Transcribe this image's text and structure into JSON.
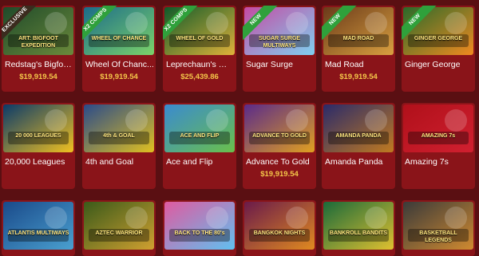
{
  "games": [
    {
      "title": "Redstag's Bigfoo...",
      "jackpot": "$19,919.54",
      "badge": "EXCLUSIVE",
      "badge_style": "dark",
      "art": "ART: BIGFOOT EXPEDITION",
      "bg": [
        "#1f4a2a",
        "#6b8a3b"
      ]
    },
    {
      "title": "Wheel Of Chanc...",
      "jackpot": "$19,919.54",
      "badge": "X2 COMPS",
      "badge_style": "green",
      "art": "WHEEL OF CHANCE",
      "bg": [
        "#1b6b8a",
        "#7bd36a"
      ]
    },
    {
      "title": "Leprechaun's Wh...",
      "jackpot": "$25,439.86",
      "badge": "X2 COMPS",
      "badge_style": "green",
      "art": "WHEEL OF GOLD",
      "bg": [
        "#0f5a2a",
        "#e0b23a"
      ]
    },
    {
      "title": "Sugar Surge",
      "jackpot": "",
      "badge": "NEW",
      "badge_style": "green",
      "art": "SUGAR SURGE MULTIWAYS",
      "bg": [
        "#c54aa3",
        "#7fd0f0"
      ]
    },
    {
      "title": "Mad Road",
      "jackpot": "$19,919.54",
      "badge": "NEW",
      "badge_style": "green",
      "art": "MAD ROAD",
      "bg": [
        "#6a3a1a",
        "#d9a040"
      ]
    },
    {
      "title": "Ginger George",
      "jackpot": "",
      "badge": "NEW",
      "badge_style": "green",
      "art": "GINGER GEORGE",
      "bg": [
        "#2a6a2a",
        "#f08a20"
      ]
    },
    {
      "title": "20,000 Leagues",
      "jackpot": "",
      "badge": "",
      "badge_style": "",
      "art": "20 000 LEAGUES",
      "bg": [
        "#0a3a6a",
        "#f0c020"
      ]
    },
    {
      "title": "4th and Goal",
      "jackpot": "",
      "badge": "",
      "badge_style": "",
      "art": "4th & GOAL",
      "bg": [
        "#2a4a8a",
        "#e0c020"
      ]
    },
    {
      "title": "Ace and Flip",
      "jackpot": "",
      "badge": "",
      "badge_style": "",
      "art": "ACE AND FLIP",
      "bg": [
        "#3a8ad0",
        "#6ac04a"
      ]
    },
    {
      "title": "Advance To Gold",
      "jackpot": "$19,919.54",
      "badge": "",
      "badge_style": "",
      "art": "ADVANCE TO GOLD",
      "bg": [
        "#5a2a8a",
        "#e0a020"
      ]
    },
    {
      "title": "Amanda Panda",
      "jackpot": "",
      "badge": "",
      "badge_style": "",
      "art": "AMANDA PANDA",
      "bg": [
        "#2a2a6a",
        "#c07a20"
      ]
    },
    {
      "title": "Amazing 7s",
      "jackpot": "",
      "badge": "",
      "badge_style": "",
      "art": "AMAZING 7s",
      "bg": [
        "#b0101a",
        "#d02030"
      ]
    },
    {
      "title": "",
      "jackpot": "",
      "badge": "",
      "badge_style": "",
      "art": "ATLANTIS MULTIWAYS",
      "bg": [
        "#1a4a8a",
        "#4aa0d0"
      ]
    },
    {
      "title": "",
      "jackpot": "",
      "badge": "",
      "badge_style": "",
      "art": "AZTEC WARRIOR",
      "bg": [
        "#3a5a1a",
        "#d0a030"
      ]
    },
    {
      "title": "",
      "jackpot": "",
      "badge": "",
      "badge_style": "",
      "art": "BACK TO THE 80's",
      "bg": [
        "#e05aa0",
        "#60c0f0"
      ]
    },
    {
      "title": "",
      "jackpot": "",
      "badge": "",
      "badge_style": "",
      "art": "BANGKOK NIGHTS",
      "bg": [
        "#6a1a4a",
        "#e08a20"
      ]
    },
    {
      "title": "",
      "jackpot": "",
      "badge": "",
      "badge_style": "",
      "art": "BANKROLL BANDITS",
      "bg": [
        "#1a6a3a",
        "#e0c030"
      ]
    },
    {
      "title": "",
      "jackpot": "",
      "badge": "",
      "badge_style": "",
      "art": "BASKETBALL LEGENDS",
      "bg": [
        "#3a3a3a",
        "#d08a30"
      ]
    }
  ]
}
